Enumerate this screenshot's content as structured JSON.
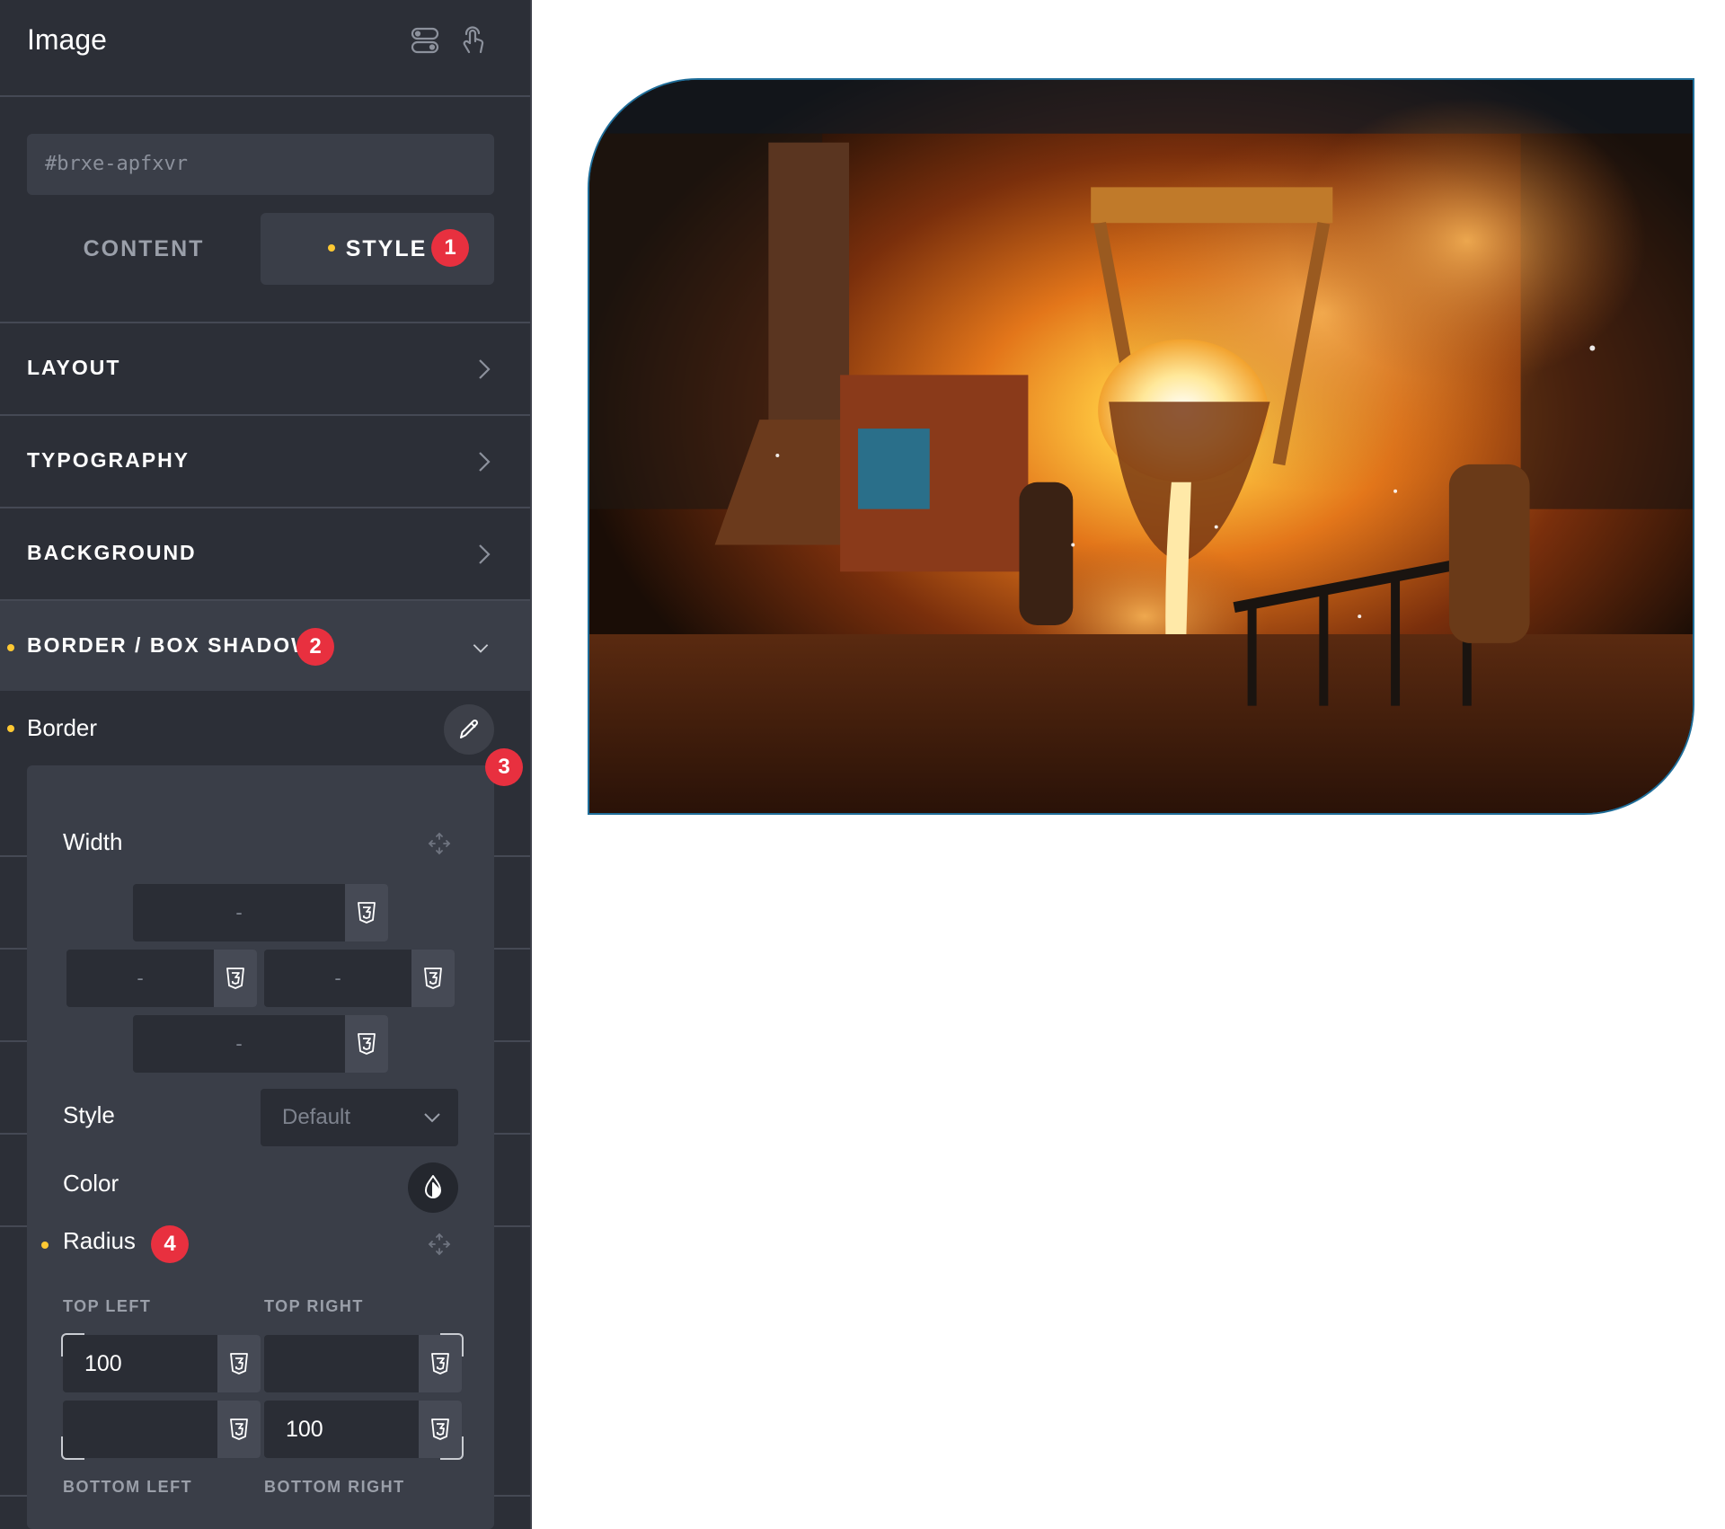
{
  "panel": {
    "title": "Image",
    "header_icons": [
      "toggle-stack-icon",
      "pointer-hand-icon"
    ],
    "css_id": "#brxe-apfxvr",
    "tabs": [
      {
        "label": "CONTENT",
        "active": false
      },
      {
        "label": "STYLE",
        "active": true,
        "badge": "1"
      }
    ],
    "sections": [
      {
        "label": "LAYOUT"
      },
      {
        "label": "TYPOGRAPHY"
      },
      {
        "label": "BACKGROUND"
      },
      {
        "label": "BORDER / BOX SHADOW",
        "badge": "2",
        "expanded": true
      }
    ],
    "border_row": {
      "label": "Border",
      "badge": "3"
    }
  },
  "border_popup": {
    "width_label": "Width",
    "width_values": {
      "top": "-",
      "left": "-",
      "right": "-",
      "bottom": "-"
    },
    "style_label": "Style",
    "style_value": "Default",
    "color_label": "Color",
    "radius_label": "Radius",
    "radius_badge": "4",
    "corners": {
      "top_left_label": "TOP LEFT",
      "top_right_label": "TOP RIGHT",
      "bottom_left_label": "BOTTOM LEFT",
      "bottom_right_label": "BOTTOM RIGHT",
      "top_left": "100",
      "top_right": "",
      "bottom_left": "",
      "bottom_right": "100"
    }
  },
  "colors": {
    "panel_bg": "#2c2f37",
    "input_bg": "#3a3e48",
    "accent_dot": "#ffc933",
    "badge": "#e8303f"
  }
}
